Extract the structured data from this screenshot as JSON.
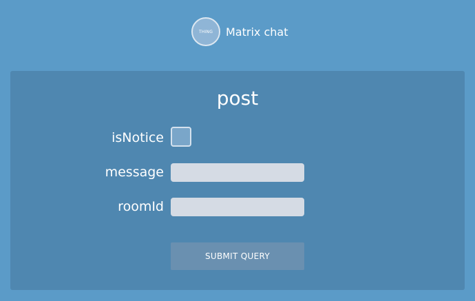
{
  "header": {
    "logo_text": "THING",
    "app_title": "Matrix chat"
  },
  "form": {
    "title": "post",
    "fields": [
      {
        "label": "isNotice",
        "type": "checkbox",
        "checked": false
      },
      {
        "label": "message",
        "type": "text",
        "value": ""
      },
      {
        "label": "roomId",
        "type": "text",
        "value": ""
      }
    ],
    "submit_label": "SUBMIT QUERY"
  },
  "colors": {
    "background": "#5b9bc8",
    "panel": "#4f87b0",
    "input": "#d5dbe4",
    "button": "#6a90b0"
  }
}
